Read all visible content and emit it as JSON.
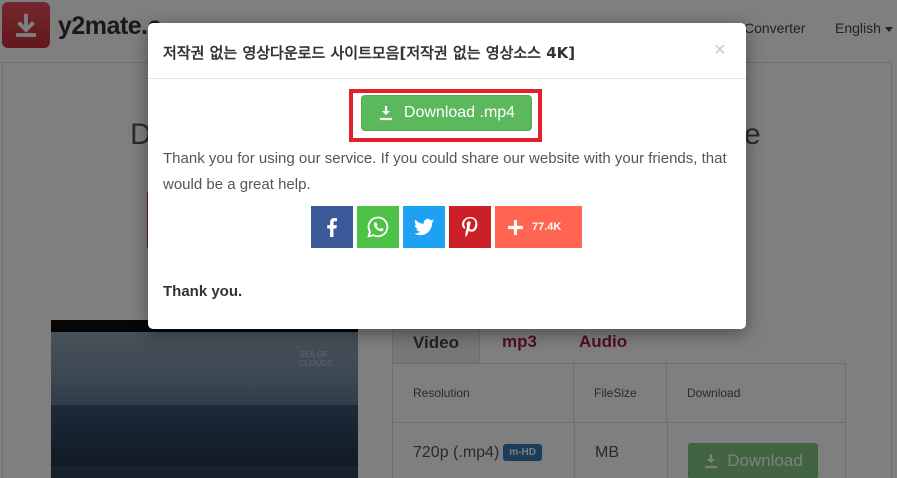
{
  "navbar": {
    "logo_text": "y2mate.c",
    "links": {
      "converter": "Converter",
      "language": "English"
    }
  },
  "page": {
    "headline_left": "D",
    "headline_right": "e",
    "video_caption": "SEA OF CLOUDS"
  },
  "tabs": {
    "video": "Video",
    "mp3": "mp3",
    "audio": "Audio"
  },
  "table": {
    "headers": {
      "resolution": "Resolution",
      "filesize": "FileSize",
      "download": "Download"
    },
    "rows": [
      {
        "resolution": "720p (.mp4)",
        "badge": "m-HD",
        "filesize": "MB",
        "download_label": "Download"
      }
    ]
  },
  "modal": {
    "title": "저작권 없는 영상다운로드 사이트모음[저작권 없는 영상소스 4K]",
    "close": "×",
    "download_label": "Download .mp4",
    "message": "Thank you for using our service. If you could share our website with your friends, that would be a great help.",
    "share": {
      "count": "77.4K"
    },
    "thank_you": "Thank you."
  },
  "colors": {
    "accent_green": "#5cb85c",
    "highlight_red": "#e1202b",
    "facebook": "#3b5998",
    "whatsapp": "#4dc247",
    "twitter": "#1da1f2",
    "pinterest": "#cb2027",
    "share_more": "#ff6550",
    "tab_accent": "#a31c4b",
    "badge_blue": "#337ab7"
  },
  "icons": {
    "logo": "download-arrow-icon",
    "download": "download-icon",
    "facebook": "facebook-icon",
    "whatsapp": "whatsapp-icon",
    "twitter": "twitter-icon",
    "pinterest": "pinterest-icon",
    "more": "plus-icon"
  }
}
